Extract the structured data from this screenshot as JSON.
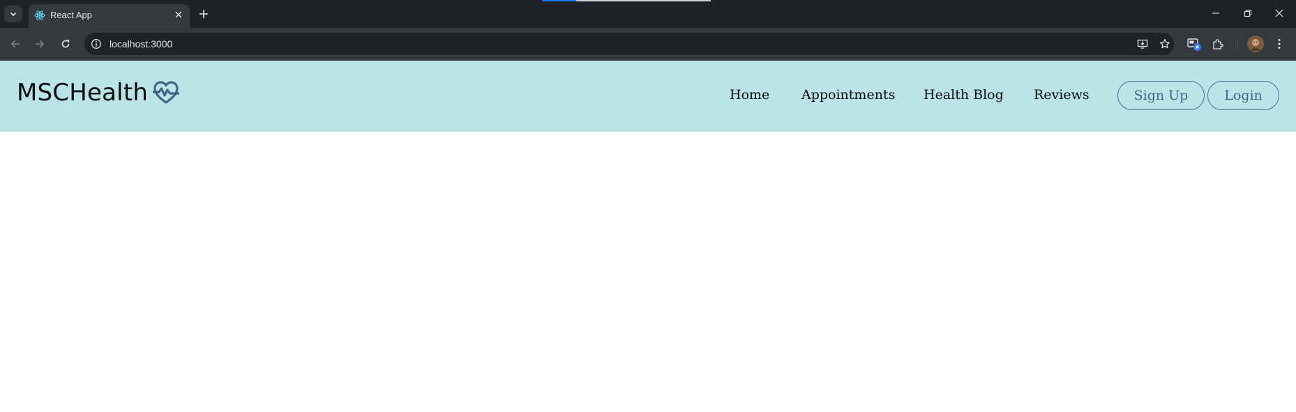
{
  "browser": {
    "tab_title": "React App",
    "url": "localhost:3000",
    "icons": {
      "tab_search": "chevron-down-icon",
      "favicon": "react-icon",
      "tab_close": "close-icon",
      "new_tab": "plus-icon",
      "back": "arrow-left-icon",
      "forward": "arrow-right-icon",
      "reload": "reload-icon",
      "site_info": "info-icon",
      "install": "install-icon",
      "bookmark": "star-icon",
      "extension_badge": "extension-badge-icon",
      "extensions": "puzzle-icon",
      "menu": "kebab-menu-icon"
    }
  },
  "site": {
    "logo_text": "MSCHealth",
    "logo_icon": "heart-pulse-icon",
    "nav": {
      "home": "Home",
      "appointments": "Appointments",
      "blog": "Health Blog",
      "reviews": "Reviews"
    },
    "buttons": {
      "signup": "Sign Up",
      "login": "Login"
    },
    "colors": {
      "header_bg": "#bae4e8",
      "button_border": "#4a6a85",
      "button_text": "#3e6583",
      "logo_icon": "#3e6583"
    }
  }
}
